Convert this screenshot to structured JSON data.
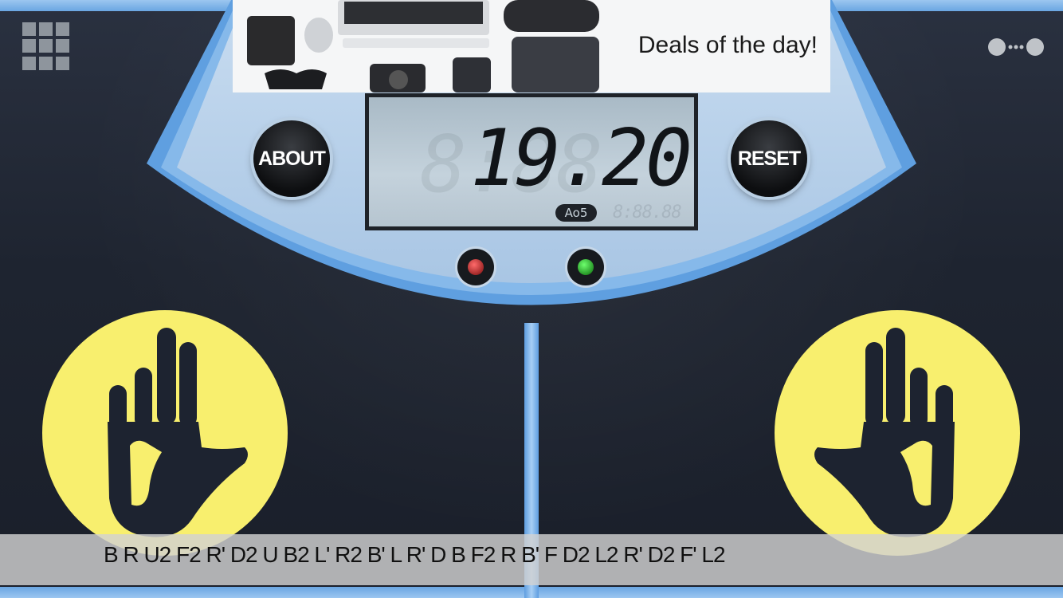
{
  "menu": {
    "icon": "grid-menu-icon"
  },
  "more": {
    "icon": "ellipsis-icon"
  },
  "ad": {
    "text": "Deals of the day!",
    "image": "electronics-gadgets-image"
  },
  "timer": {
    "time": "19.20",
    "ghost_digits": "8:88",
    "ao5_label": "Ao5",
    "ao5_value": "8:88.88"
  },
  "buttons": {
    "about": "ABOUT",
    "reset": "RESET"
  },
  "indicators": {
    "left_color": "#d01a1a",
    "right_color": "#1ab01a"
  },
  "pads": {
    "left_icon": "left-hand-icon",
    "right_icon": "right-hand-icon",
    "color": "#f8ef6e"
  },
  "scramble": "B R U2 F2 R' D2 U B2 L' R2 B' L R' D B F2 R B' F D2 L2 R' D2 F' L2"
}
